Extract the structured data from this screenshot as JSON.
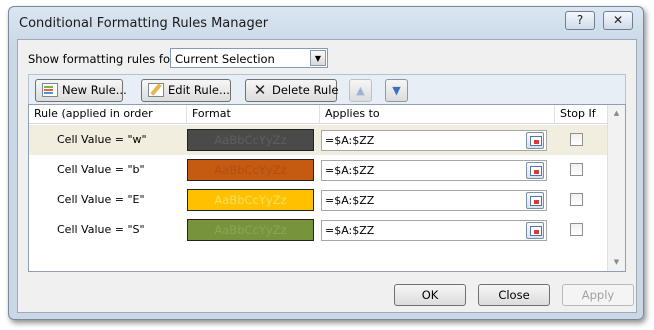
{
  "window": {
    "title": "Conditional Formatting Rules Manager",
    "help_label": "?",
    "close_label": "✕"
  },
  "filter": {
    "label": "Show formatting rules for:",
    "selected": "Current Selection"
  },
  "toolbar": {
    "new_rule": "New Rule...",
    "edit_rule": "Edit Rule...",
    "delete_rule": "Delete Rule",
    "move_up": "▲",
    "move_down": "▼"
  },
  "table": {
    "columns": [
      "Rule (applied in order shown)",
      "Format",
      "Applies to",
      "Stop If True"
    ],
    "rows": [
      {
        "condition": "Cell Value = \"w\"",
        "preview": "AaBbCcYyZz",
        "applies_to": "=$A:$ZZ",
        "stop_if_true": false,
        "bg": "#4a4a4a",
        "fg": "#5e5e5e"
      },
      {
        "condition": "Cell Value = \"b\"",
        "preview": "AaBbCcYyZz",
        "applies_to": "=$A:$ZZ",
        "stop_if_true": false,
        "bg": "#c55a11",
        "fg": "#b05010"
      },
      {
        "condition": "Cell Value = \"E\"",
        "preview": "AaBbCcYyZz",
        "applies_to": "=$A:$ZZ",
        "stop_if_true": false,
        "bg": "#ffc000",
        "fg": "#f2e060"
      },
      {
        "condition": "Cell Value = \"S\"",
        "preview": "AaBbCcYyZz",
        "applies_to": "=$A:$ZZ",
        "stop_if_true": false,
        "bg": "#77933c",
        "fg": "#8aa653"
      }
    ]
  },
  "footer": {
    "ok": "OK",
    "close": "Close",
    "apply": "Apply"
  }
}
